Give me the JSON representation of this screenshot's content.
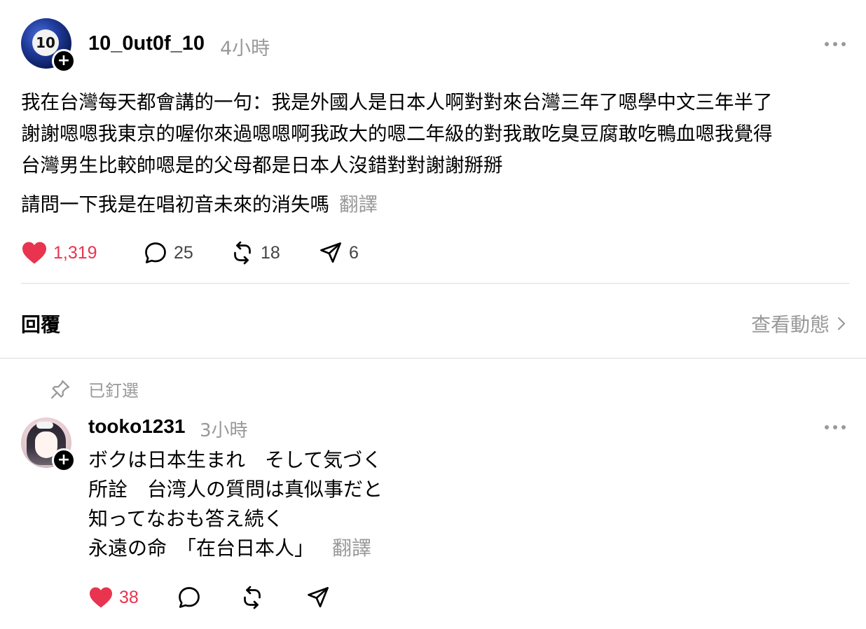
{
  "post": {
    "username": "10_0ut0f_10",
    "time": "4小時",
    "avatar_number": "10",
    "body_lines": [
      "我在台灣每天都會講的一句：我是外國人是日本人啊對對來台灣三年了嗯學中文三年半了",
      "謝謝嗯嗯我東京的喔你來過嗯嗯啊我政大的嗯二年級的對我敢吃臭豆腐敢吃鴨血嗯我覺得",
      "台灣男生比較帥嗯是的父母都是日本人沒錯對對謝謝掰掰"
    ],
    "question": "請問一下我是在唱初音未來的消失嗎",
    "translate_label": "翻譯",
    "likes": "1,319",
    "comments": "25",
    "reposts": "18",
    "shares": "6"
  },
  "replies_header": {
    "title": "回覆",
    "view_activity": "查看動態"
  },
  "pinned_label": "已釘選",
  "reply": {
    "username": "tooko1231",
    "time": "3小時",
    "lines": [
      "ボクは日本生まれ　そして気づく",
      "所詮　台湾人の質問は真似事だと",
      "知ってなおも答え続く"
    ],
    "last_line": "永遠の命　「在台日本人」",
    "translate_label": "翻譯",
    "likes": "38"
  },
  "colors": {
    "like_red": "#e8344e",
    "muted_gray": "#999999",
    "divider": "#dcdcdc"
  }
}
